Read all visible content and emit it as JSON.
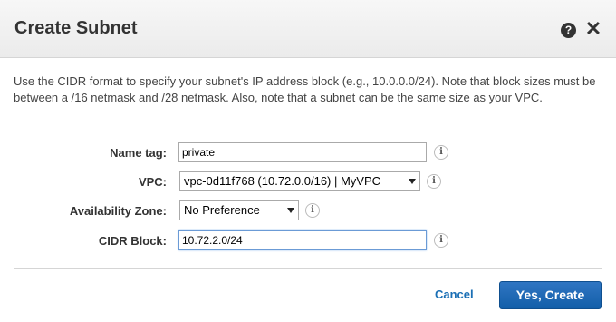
{
  "dialog": {
    "title": "Create Subnet",
    "help_icon": "?",
    "close_icon": "✕"
  },
  "description": "Use the CIDR format to specify your subnet's IP address block (e.g., 10.0.0.0/24). Note that block sizes must be between a /16 netmask and /28 netmask. Also, note that a subnet can be the same size as your VPC.",
  "form": {
    "name_tag": {
      "label": "Name tag:",
      "value": "private"
    },
    "vpc": {
      "label": "VPC:",
      "value": "vpc-0d11f768 (10.72.0.0/16) | MyVPC"
    },
    "availability_zone": {
      "label": "Availability Zone:",
      "value": "No Preference"
    },
    "cidr_block": {
      "label": "CIDR Block:",
      "value": "10.72.2.0/24"
    },
    "info_icon": "i"
  },
  "footer": {
    "cancel_label": "Cancel",
    "create_label": "Yes, Create"
  },
  "colors": {
    "primary_button": "#1f68b5",
    "link": "#1a6fb5"
  }
}
